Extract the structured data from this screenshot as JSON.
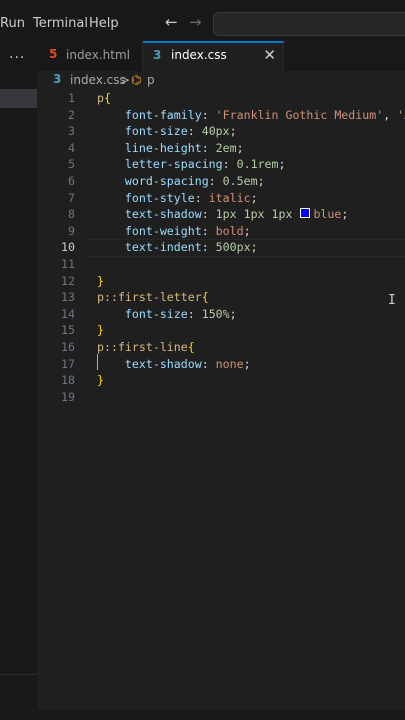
{
  "menu": [
    "Run",
    "Terminal",
    "Help"
  ],
  "nav": {
    "back": "←",
    "forward": "→"
  },
  "sidebar": {
    "more": "···"
  },
  "tabs": [
    {
      "label": "index.html",
      "icon": "5"
    },
    {
      "label": "index.css",
      "icon": "3",
      "close": "✕"
    }
  ],
  "breadcrumb": {
    "file": "index.css",
    "separator": ">",
    "symbol_icon": "⌬",
    "symbol": "p"
  },
  "editor": {
    "line_numbers": [
      "1",
      "2",
      "3",
      "4",
      "5",
      "6",
      "7",
      "8",
      "9",
      "10",
      "11",
      "12",
      "13",
      "14",
      "15",
      "16",
      "17",
      "18",
      "19"
    ],
    "active_line": "10",
    "lines": [
      [
        {
          "t": "p",
          "c": "sel"
        },
        {
          "t": "{",
          "c": "br"
        }
      ],
      [
        {
          "t": "    "
        },
        {
          "t": "font-family",
          "c": "prop"
        },
        {
          "t": ": ",
          "c": "pu"
        },
        {
          "t": "'Franklin Gothic Medium'",
          "c": "val"
        },
        {
          "t": ", ",
          "c": "pu"
        },
        {
          "t": "'Ar",
          "c": "val"
        }
      ],
      [
        {
          "t": "    "
        },
        {
          "t": "font-size",
          "c": "prop"
        },
        {
          "t": ": ",
          "c": "pu"
        },
        {
          "t": "40px",
          "c": "num"
        },
        {
          "t": ";",
          "c": "pu"
        }
      ],
      [
        {
          "t": "    "
        },
        {
          "t": "line-height",
          "c": "prop"
        },
        {
          "t": ": ",
          "c": "pu"
        },
        {
          "t": "2em",
          "c": "num"
        },
        {
          "t": ";",
          "c": "pu"
        }
      ],
      [
        {
          "t": "    "
        },
        {
          "t": "letter-spacing",
          "c": "prop"
        },
        {
          "t": ": ",
          "c": "pu"
        },
        {
          "t": "0.1rem",
          "c": "num"
        },
        {
          "t": ";",
          "c": "pu"
        }
      ],
      [
        {
          "t": "    "
        },
        {
          "t": "word-spacing",
          "c": "prop"
        },
        {
          "t": ": ",
          "c": "pu"
        },
        {
          "t": "0.5em",
          "c": "num"
        },
        {
          "t": ";",
          "c": "pu"
        }
      ],
      [
        {
          "t": "    "
        },
        {
          "t": "font-style",
          "c": "prop"
        },
        {
          "t": ": ",
          "c": "pu"
        },
        {
          "t": "italic",
          "c": "val"
        },
        {
          "t": ";",
          "c": "pu"
        }
      ],
      [
        {
          "t": "    "
        },
        {
          "t": "text-shadow",
          "c": "prop"
        },
        {
          "t": ": ",
          "c": "pu"
        },
        {
          "t": "1px 1px 1px ",
          "c": "num"
        },
        {
          "swatch": "#0000ff"
        },
        {
          "t": "blue",
          "c": "val"
        },
        {
          "t": ";",
          "c": "pu"
        }
      ],
      [
        {
          "t": "    "
        },
        {
          "t": "font-weight",
          "c": "prop"
        },
        {
          "t": ": ",
          "c": "pu"
        },
        {
          "t": "bold",
          "c": "val"
        },
        {
          "t": ";",
          "c": "pu"
        }
      ],
      [
        {
          "t": "    "
        },
        {
          "t": "text-indent",
          "c": "prop"
        },
        {
          "t": ": ",
          "c": "pu"
        },
        {
          "t": "500px",
          "c": "num"
        },
        {
          "t": ";",
          "c": "pu"
        }
      ],
      [],
      [
        {
          "t": "}",
          "c": "br"
        }
      ],
      [
        {
          "t": "p::first-letter",
          "c": "sel"
        },
        {
          "t": "{",
          "c": "br"
        }
      ],
      [
        {
          "t": "    "
        },
        {
          "t": "font-size",
          "c": "prop"
        },
        {
          "t": ": ",
          "c": "pu"
        },
        {
          "t": "150%",
          "c": "num"
        },
        {
          "t": ";",
          "c": "pu"
        }
      ],
      [
        {
          "t": "}",
          "c": "br"
        }
      ],
      [
        {
          "t": "p::first-line",
          "c": "sel"
        },
        {
          "t": "{",
          "c": "br"
        }
      ],
      [
        {
          "t": "    "
        },
        {
          "t": "text-shadow",
          "c": "prop"
        },
        {
          "t": ": ",
          "c": "pu"
        },
        {
          "t": "none",
          "c": "val"
        },
        {
          "t": ";",
          "c": "pu"
        }
      ],
      [
        {
          "t": "}",
          "c": "br"
        }
      ],
      []
    ]
  },
  "colors": {
    "accent": "#0078d4",
    "css_icon": "#519aba",
    "html_icon": "#e44d26",
    "swatch": "#0000ff"
  }
}
